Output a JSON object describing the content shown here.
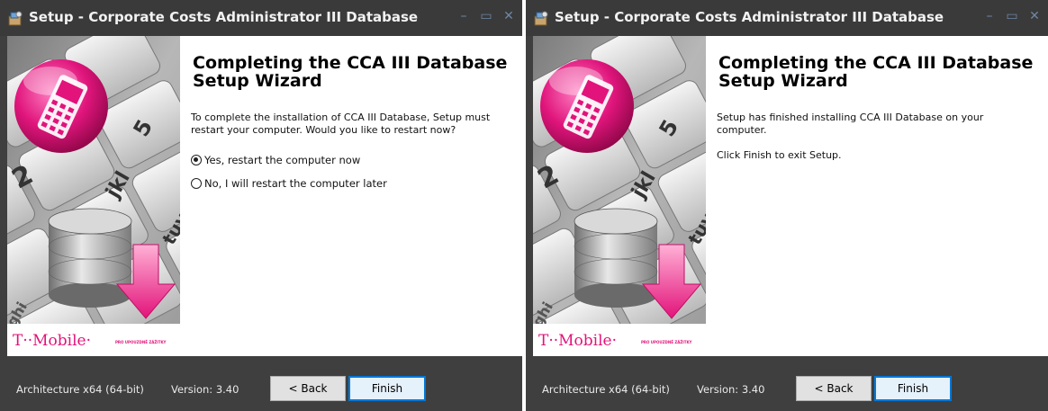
{
  "left_window": {
    "title": "Setup - Corporate Costs Administrator III Database",
    "heading": "Completing the CCA III Database Setup Wizard",
    "message": "To complete the installation of CCA III Database, Setup must restart your computer. Would you like to restart now?",
    "options": [
      {
        "label": "Yes, restart the computer now",
        "selected": true
      },
      {
        "label": "No, I will restart the computer later",
        "selected": false
      }
    ],
    "footer": {
      "architecture": "Architecture x64 (64-bit)",
      "version": "Version: 3.40",
      "back_label": "< Back",
      "finish_label": "Finish"
    }
  },
  "right_window": {
    "title": "Setup - Corporate Costs Administrator III Database",
    "heading": "Completing the CCA III Database Setup Wizard",
    "message": "Setup has finished installing CCA III Database on your computer.",
    "message2": "Click Finish to exit Setup.",
    "footer": {
      "architecture": "Architecture x64 (64-bit)",
      "version": "Version: 3.40",
      "back_label": "< Back",
      "finish_label": "Finish"
    }
  },
  "side_image": {
    "brand": "T··Mobile·",
    "tagline": "PRO UPOUZDNĚ ZÁŽITKY",
    "keys": [
      "2",
      "jkl",
      "5",
      "tuv",
      "ghi"
    ]
  },
  "icons": [
    "setup-app-icon",
    "minimize-icon",
    "maximize-icon",
    "close-icon",
    "mobile-phone-icon",
    "database-icon",
    "download-arrow-icon"
  ],
  "colors": {
    "window_frame": "#3f3f3f",
    "accent_magenta": "#e2137a",
    "finish_border": "#0078d7",
    "titlebar_buttons": "#6d87a5"
  }
}
